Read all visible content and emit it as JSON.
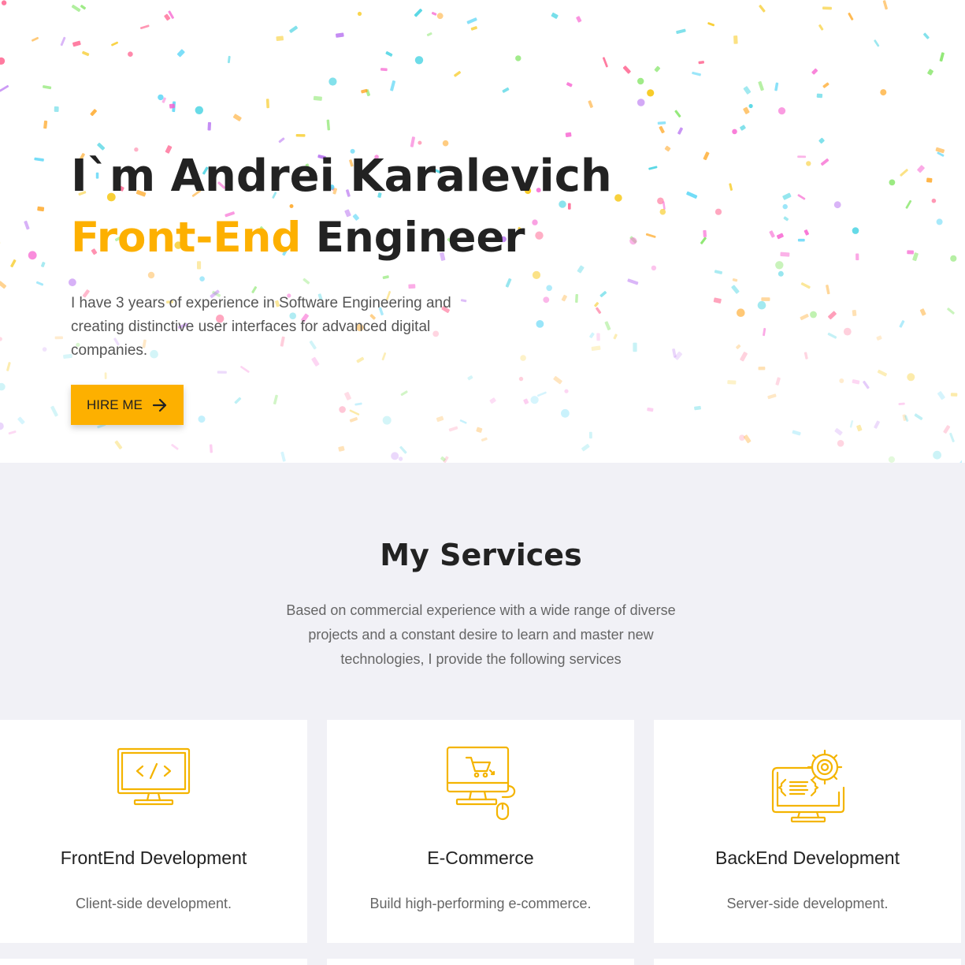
{
  "hero": {
    "name_line": "I`m Andrei Karalevich",
    "role_accent": "Front-End",
    "role_rest": " Engineer",
    "description": "I have 3 years of experience in Software Engineering and creating distinctive user interfaces for advanced digital companies.",
    "cta_label": "HIRE ME",
    "cta_icon": "arrow-right-icon"
  },
  "services": {
    "title": "My Services",
    "description": "Based on commercial experience with a wide range of diverse projects and a constant desire to learn and master new technologies, I provide the following services",
    "items": [
      {
        "title": "FrontEnd Development",
        "description": "Client-side development.",
        "icon": "monitor-code-icon"
      },
      {
        "title": "E-Commerce",
        "description": "Build high-performing e-commerce.",
        "icon": "monitor-cart-icon"
      },
      {
        "title": "BackEnd Development",
        "description": "Server-side development.",
        "icon": "monitor-gear-icon"
      }
    ]
  },
  "colors": {
    "accent": "#fdb000",
    "text_dark": "#222222",
    "text_muted": "#666666",
    "section_bg": "#f1f1f6",
    "confetti": [
      "#f6c200",
      "#4fd3f5",
      "#b36af0",
      "#ff5c8a",
      "#7be35b",
      "#ffa31a",
      "#3ad0e0",
      "#f75fcf"
    ]
  }
}
